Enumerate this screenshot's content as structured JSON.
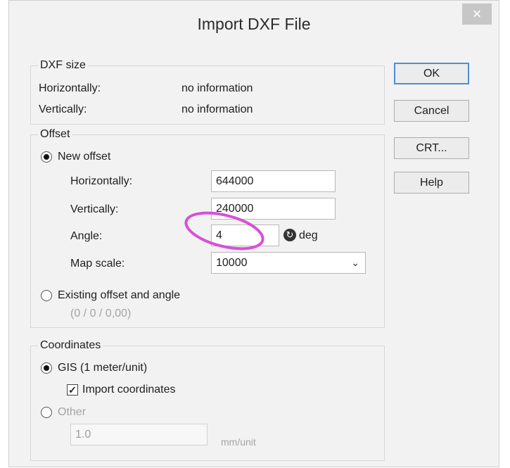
{
  "window": {
    "title": "Import DXF File",
    "close_glyph": "×"
  },
  "dxf_size": {
    "title": "DXF size",
    "horizontally_label": "Horizontally:",
    "horizontally_value": "no information",
    "vertically_label": "Vertically:",
    "vertically_value": "no information"
  },
  "offset": {
    "title": "Offset",
    "new_offset_label": "New offset",
    "new_offset_selected": true,
    "horizontally_label": "Horizontally:",
    "horizontally_value": "644000",
    "vertically_label": "Vertically:",
    "vertically_value": "240000",
    "angle_label": "Angle:",
    "angle_value": "4",
    "angle_unit": "deg",
    "map_scale_label": "Map scale:",
    "map_scale_value": "10000",
    "existing_label": "Existing offset and angle",
    "existing_selected": false,
    "existing_value": "(0 / 0 / 0,00)"
  },
  "coordinates": {
    "title": "Coordinates",
    "gis_label": "GIS (1 meter/unit)",
    "gis_selected": true,
    "import_label": "Import coordinates",
    "import_checked": true,
    "other_label": "Other",
    "other_selected": false,
    "other_value": "1.0",
    "other_unit": "mm/unit"
  },
  "buttons": {
    "ok": "OK",
    "cancel": "Cancel",
    "crt": "CRT...",
    "help": "Help"
  },
  "annotation": {
    "highlight_color": "#d84fd8"
  },
  "icons": {
    "close": "close-icon",
    "radio": "radio-icon",
    "checkbox": "checkbox-icon",
    "dropdown": "chevron-down-icon",
    "rotate": "rotate-icon"
  }
}
